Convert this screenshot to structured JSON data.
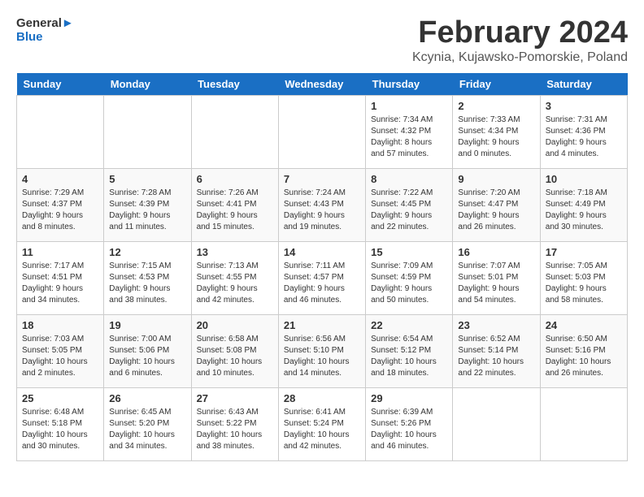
{
  "header": {
    "logo_line1": "General",
    "logo_line2": "Blue",
    "month_year": "February 2024",
    "location": "Kcynia, Kujawsko-Pomorskie, Poland"
  },
  "days_of_week": [
    "Sunday",
    "Monday",
    "Tuesday",
    "Wednesday",
    "Thursday",
    "Friday",
    "Saturday"
  ],
  "weeks": [
    [
      {
        "day": "",
        "sunrise": "",
        "sunset": "",
        "daylight": ""
      },
      {
        "day": "",
        "sunrise": "",
        "sunset": "",
        "daylight": ""
      },
      {
        "day": "",
        "sunrise": "",
        "sunset": "",
        "daylight": ""
      },
      {
        "day": "",
        "sunrise": "",
        "sunset": "",
        "daylight": ""
      },
      {
        "day": "1",
        "sunrise": "Sunrise: 7:34 AM",
        "sunset": "Sunset: 4:32 PM",
        "daylight": "Daylight: 8 hours and 57 minutes."
      },
      {
        "day": "2",
        "sunrise": "Sunrise: 7:33 AM",
        "sunset": "Sunset: 4:34 PM",
        "daylight": "Daylight: 9 hours and 0 minutes."
      },
      {
        "day": "3",
        "sunrise": "Sunrise: 7:31 AM",
        "sunset": "Sunset: 4:36 PM",
        "daylight": "Daylight: 9 hours and 4 minutes."
      }
    ],
    [
      {
        "day": "4",
        "sunrise": "Sunrise: 7:29 AM",
        "sunset": "Sunset: 4:37 PM",
        "daylight": "Daylight: 9 hours and 8 minutes."
      },
      {
        "day": "5",
        "sunrise": "Sunrise: 7:28 AM",
        "sunset": "Sunset: 4:39 PM",
        "daylight": "Daylight: 9 hours and 11 minutes."
      },
      {
        "day": "6",
        "sunrise": "Sunrise: 7:26 AM",
        "sunset": "Sunset: 4:41 PM",
        "daylight": "Daylight: 9 hours and 15 minutes."
      },
      {
        "day": "7",
        "sunrise": "Sunrise: 7:24 AM",
        "sunset": "Sunset: 4:43 PM",
        "daylight": "Daylight: 9 hours and 19 minutes."
      },
      {
        "day": "8",
        "sunrise": "Sunrise: 7:22 AM",
        "sunset": "Sunset: 4:45 PM",
        "daylight": "Daylight: 9 hours and 22 minutes."
      },
      {
        "day": "9",
        "sunrise": "Sunrise: 7:20 AM",
        "sunset": "Sunset: 4:47 PM",
        "daylight": "Daylight: 9 hours and 26 minutes."
      },
      {
        "day": "10",
        "sunrise": "Sunrise: 7:18 AM",
        "sunset": "Sunset: 4:49 PM",
        "daylight": "Daylight: 9 hours and 30 minutes."
      }
    ],
    [
      {
        "day": "11",
        "sunrise": "Sunrise: 7:17 AM",
        "sunset": "Sunset: 4:51 PM",
        "daylight": "Daylight: 9 hours and 34 minutes."
      },
      {
        "day": "12",
        "sunrise": "Sunrise: 7:15 AM",
        "sunset": "Sunset: 4:53 PM",
        "daylight": "Daylight: 9 hours and 38 minutes."
      },
      {
        "day": "13",
        "sunrise": "Sunrise: 7:13 AM",
        "sunset": "Sunset: 4:55 PM",
        "daylight": "Daylight: 9 hours and 42 minutes."
      },
      {
        "day": "14",
        "sunrise": "Sunrise: 7:11 AM",
        "sunset": "Sunset: 4:57 PM",
        "daylight": "Daylight: 9 hours and 46 minutes."
      },
      {
        "day": "15",
        "sunrise": "Sunrise: 7:09 AM",
        "sunset": "Sunset: 4:59 PM",
        "daylight": "Daylight: 9 hours and 50 minutes."
      },
      {
        "day": "16",
        "sunrise": "Sunrise: 7:07 AM",
        "sunset": "Sunset: 5:01 PM",
        "daylight": "Daylight: 9 hours and 54 minutes."
      },
      {
        "day": "17",
        "sunrise": "Sunrise: 7:05 AM",
        "sunset": "Sunset: 5:03 PM",
        "daylight": "Daylight: 9 hours and 58 minutes."
      }
    ],
    [
      {
        "day": "18",
        "sunrise": "Sunrise: 7:03 AM",
        "sunset": "Sunset: 5:05 PM",
        "daylight": "Daylight: 10 hours and 2 minutes."
      },
      {
        "day": "19",
        "sunrise": "Sunrise: 7:00 AM",
        "sunset": "Sunset: 5:06 PM",
        "daylight": "Daylight: 10 hours and 6 minutes."
      },
      {
        "day": "20",
        "sunrise": "Sunrise: 6:58 AM",
        "sunset": "Sunset: 5:08 PM",
        "daylight": "Daylight: 10 hours and 10 minutes."
      },
      {
        "day": "21",
        "sunrise": "Sunrise: 6:56 AM",
        "sunset": "Sunset: 5:10 PM",
        "daylight": "Daylight: 10 hours and 14 minutes."
      },
      {
        "day": "22",
        "sunrise": "Sunrise: 6:54 AM",
        "sunset": "Sunset: 5:12 PM",
        "daylight": "Daylight: 10 hours and 18 minutes."
      },
      {
        "day": "23",
        "sunrise": "Sunrise: 6:52 AM",
        "sunset": "Sunset: 5:14 PM",
        "daylight": "Daylight: 10 hours and 22 minutes."
      },
      {
        "day": "24",
        "sunrise": "Sunrise: 6:50 AM",
        "sunset": "Sunset: 5:16 PM",
        "daylight": "Daylight: 10 hours and 26 minutes."
      }
    ],
    [
      {
        "day": "25",
        "sunrise": "Sunrise: 6:48 AM",
        "sunset": "Sunset: 5:18 PM",
        "daylight": "Daylight: 10 hours and 30 minutes."
      },
      {
        "day": "26",
        "sunrise": "Sunrise: 6:45 AM",
        "sunset": "Sunset: 5:20 PM",
        "daylight": "Daylight: 10 hours and 34 minutes."
      },
      {
        "day": "27",
        "sunrise": "Sunrise: 6:43 AM",
        "sunset": "Sunset: 5:22 PM",
        "daylight": "Daylight: 10 hours and 38 minutes."
      },
      {
        "day": "28",
        "sunrise": "Sunrise: 6:41 AM",
        "sunset": "Sunset: 5:24 PM",
        "daylight": "Daylight: 10 hours and 42 minutes."
      },
      {
        "day": "29",
        "sunrise": "Sunrise: 6:39 AM",
        "sunset": "Sunset: 5:26 PM",
        "daylight": "Daylight: 10 hours and 46 minutes."
      },
      {
        "day": "",
        "sunrise": "",
        "sunset": "",
        "daylight": ""
      },
      {
        "day": "",
        "sunrise": "",
        "sunset": "",
        "daylight": ""
      }
    ]
  ]
}
